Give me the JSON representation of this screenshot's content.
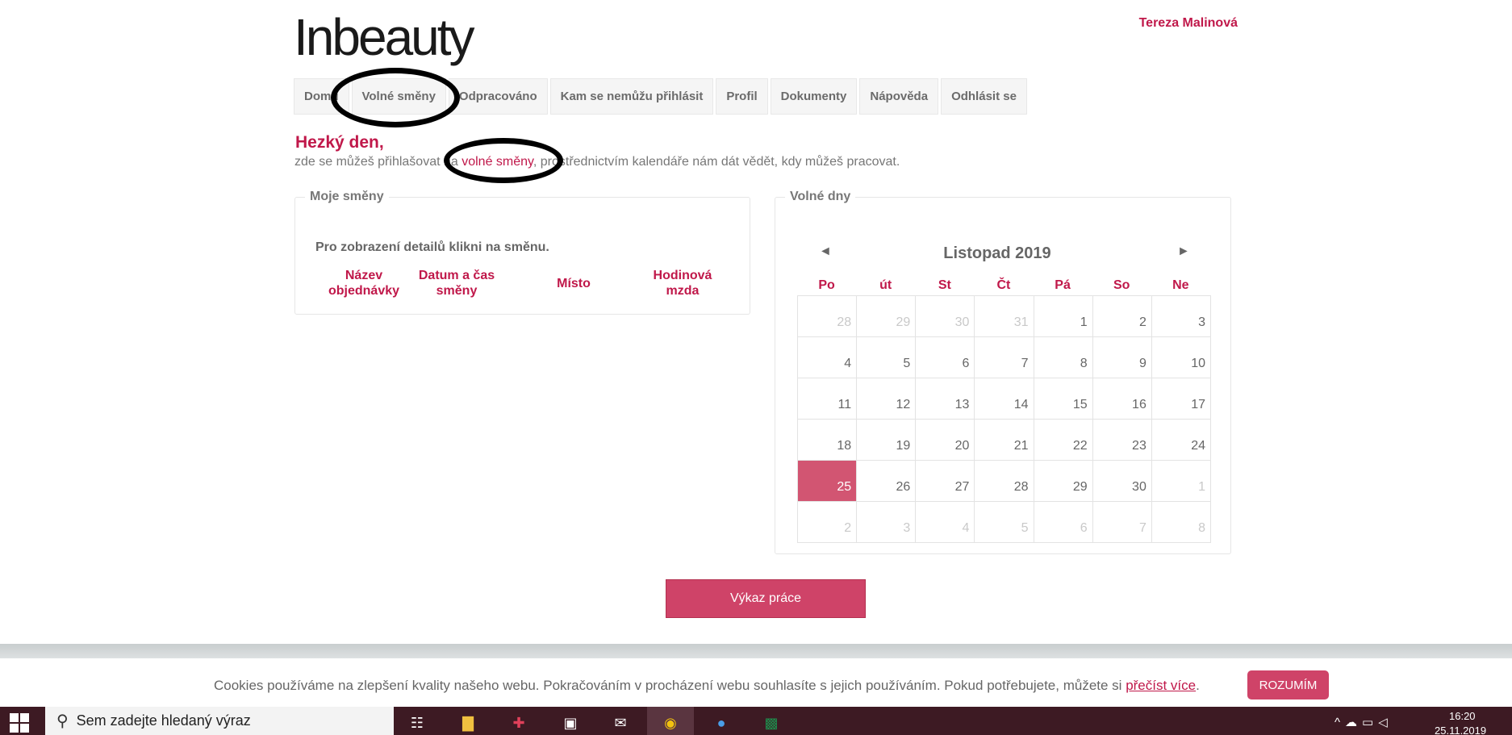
{
  "header": {
    "logo_text": "Inbeauty",
    "user_name": "Tereza Malinová"
  },
  "nav": {
    "items": [
      {
        "label": "Domů"
      },
      {
        "label": "Volné směny"
      },
      {
        "label": "Odpracováno"
      },
      {
        "label": "Kam se nemůžu přihlásit"
      },
      {
        "label": "Profil"
      },
      {
        "label": "Dokumenty"
      },
      {
        "label": "Nápověda"
      },
      {
        "label": "Odhlásit se"
      }
    ]
  },
  "greeting": {
    "title": "Hezký den,",
    "text_before": "zde se můžeš přihlašovat na ",
    "link": "volné směny",
    "text_after": ", prostřednictvím kalendáře nám dát vědět, kdy můžeš pracovat."
  },
  "my_shifts": {
    "legend": "Moje směny",
    "hint": "Pro zobrazení detailů klikni na směnu.",
    "columns": [
      "Název objednávky",
      "Datum a čas směny",
      "Místo",
      "Hodinová mzda"
    ]
  },
  "free_days": {
    "legend": "Volné dny",
    "prev": "◄",
    "next": "►",
    "month_title": "Listopad 2019",
    "weekdays": [
      "Po",
      "út",
      "St",
      "Čt",
      "Pá",
      "So",
      "Ne"
    ],
    "days": [
      {
        "d": "28",
        "muted": true
      },
      {
        "d": "29",
        "muted": true
      },
      {
        "d": "30",
        "muted": true
      },
      {
        "d": "31",
        "muted": true
      },
      {
        "d": "1"
      },
      {
        "d": "2"
      },
      {
        "d": "3"
      },
      {
        "d": "4"
      },
      {
        "d": "5"
      },
      {
        "d": "6"
      },
      {
        "d": "7"
      },
      {
        "d": "8"
      },
      {
        "d": "9"
      },
      {
        "d": "10"
      },
      {
        "d": "11"
      },
      {
        "d": "12"
      },
      {
        "d": "13"
      },
      {
        "d": "14"
      },
      {
        "d": "15"
      },
      {
        "d": "16"
      },
      {
        "d": "17"
      },
      {
        "d": "18"
      },
      {
        "d": "19"
      },
      {
        "d": "20"
      },
      {
        "d": "21"
      },
      {
        "d": "22"
      },
      {
        "d": "23"
      },
      {
        "d": "24"
      },
      {
        "d": "25",
        "today": true
      },
      {
        "d": "26"
      },
      {
        "d": "27"
      },
      {
        "d": "28"
      },
      {
        "d": "29"
      },
      {
        "d": "30"
      },
      {
        "d": "1",
        "muted": true
      },
      {
        "d": "2",
        "muted": true
      },
      {
        "d": "3",
        "muted": true
      },
      {
        "d": "4",
        "muted": true
      },
      {
        "d": "5",
        "muted": true
      },
      {
        "d": "6",
        "muted": true
      },
      {
        "d": "7",
        "muted": true
      },
      {
        "d": "8",
        "muted": true
      }
    ]
  },
  "report_button": "Výkaz práce",
  "cookie": {
    "text": "Cookies používáme na zlepšení kvality našeho webu. Pokračováním v procházení webu souhlasíte s jejich používáním. Pokud potřebujete, můžete si ",
    "link": "přečíst více",
    "end": ".",
    "button": "ROZUMÍM"
  },
  "taskbar": {
    "search_placeholder": "Sem zadejte hledaný výraz",
    "time": "16:20",
    "date": "25.11.2019"
  },
  "colors": {
    "accent": "#c0184a",
    "button": "#cf4368",
    "today": "#d25572",
    "taskbar": "#3d1a23"
  }
}
